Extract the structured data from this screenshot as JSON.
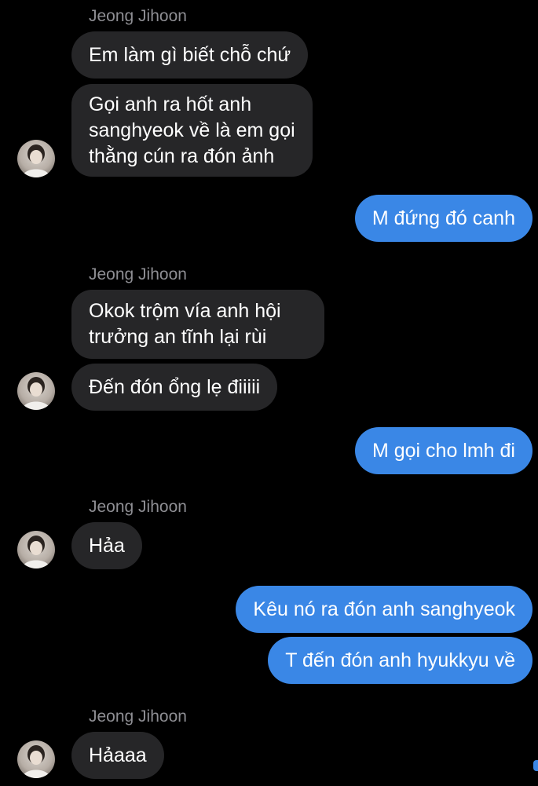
{
  "conversation": {
    "groups": [
      {
        "sender": "Jeong Jihoon",
        "messages": [
          "Em làm gì biết chỗ chứ",
          [
            "Gọi anh ra hốt anh",
            "sanghyeok về là em gọi",
            "thằng cún ra đón ảnh"
          ]
        ]
      },
      {
        "outgoing": [
          "M đứng đó canh"
        ]
      },
      {
        "sender": "Jeong Jihoon",
        "messages": [
          [
            "Okok trộm vía anh hội",
            "trưởng an tĩnh lại rùi"
          ],
          "Đến đón ổng lẹ điiiii"
        ]
      },
      {
        "outgoing": [
          "M gọi cho lmh đi"
        ]
      },
      {
        "sender": "Jeong Jihoon",
        "messages": [
          "Hảa"
        ]
      },
      {
        "outgoing": [
          "Kêu nó ra đón anh sanghyeok",
          "T đến đón anh hyukkyu về"
        ]
      },
      {
        "sender": "Jeong Jihoon",
        "messages": [
          "Hảaaa"
        ]
      }
    ]
  },
  "colors": {
    "background": "#000000",
    "incoming_bubble": "#262628",
    "outgoing_bubble": "#3a87e6",
    "sender_name": "#8e8e93"
  },
  "icons": {
    "avatar": "contact-avatar-photo"
  }
}
